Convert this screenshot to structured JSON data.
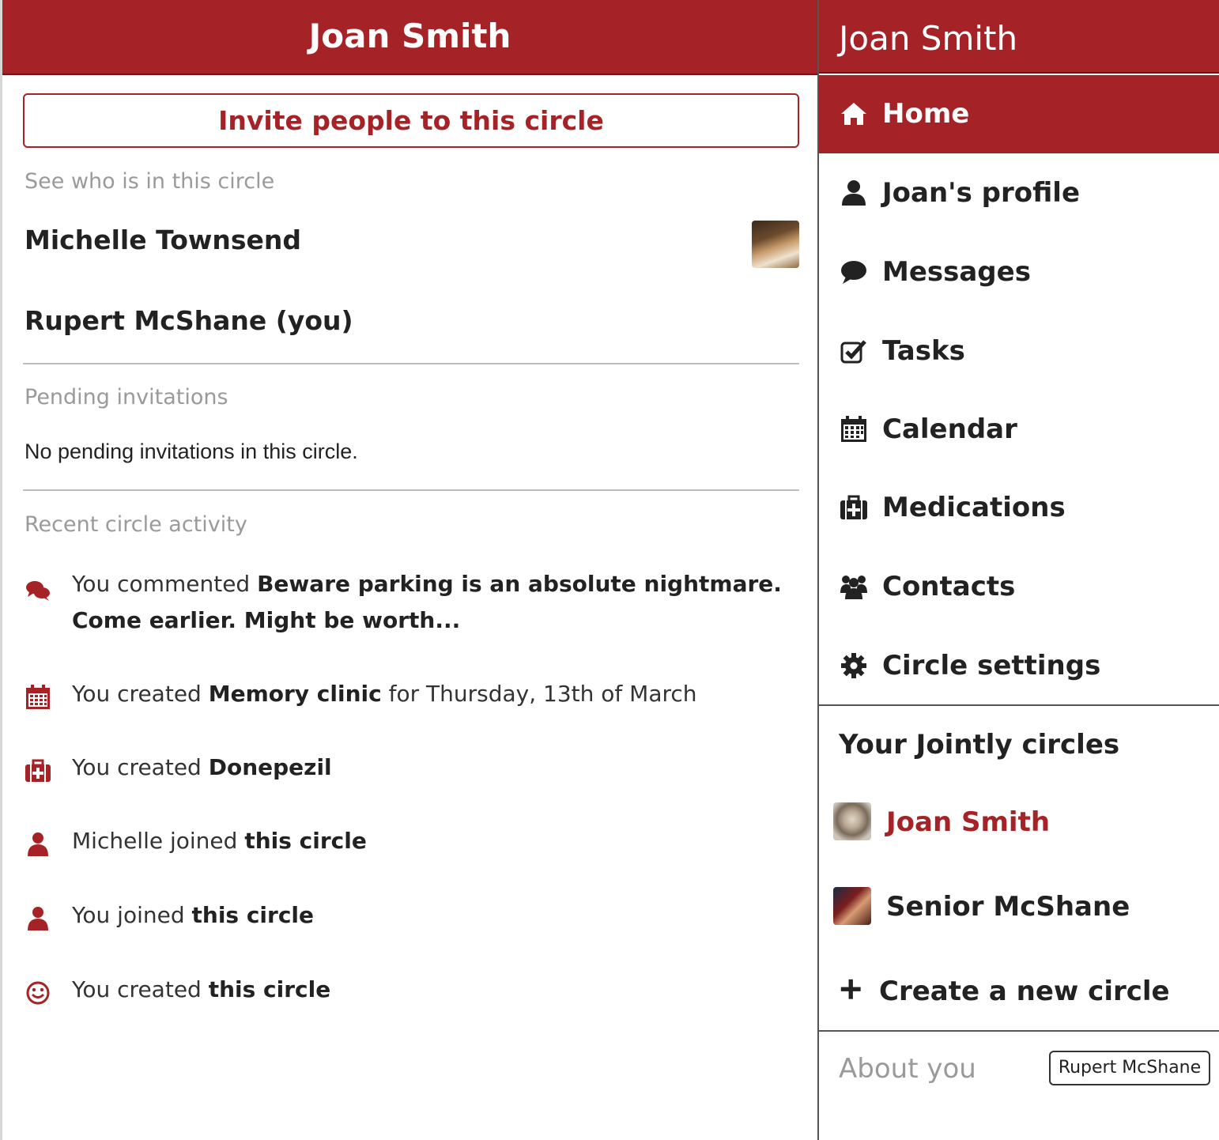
{
  "main": {
    "title": "Joan Smith",
    "invite_label": "Invite people to this circle",
    "members_heading": "See who is in this circle",
    "members": [
      "Michelle Townsend",
      "Rupert McShane (you)"
    ],
    "pending_heading": "Pending invitations",
    "pending_text": "No pending invitations in this circle.",
    "activity_heading": "Recent circle activity",
    "activity": [
      {
        "icon": "comments-icon",
        "pre": "You commented ",
        "bold": "Beware parking is an absolute nightmare. Come earlier. Might be worth...",
        "post": ""
      },
      {
        "icon": "calendar-icon",
        "pre": "You created ",
        "bold": "Memory clinic",
        "post": " for Thursday, 13th of March"
      },
      {
        "icon": "medkit-icon",
        "pre": "You created ",
        "bold": "Donepezil",
        "post": ""
      },
      {
        "icon": "user-icon",
        "pre": "Michelle joined ",
        "bold": "this circle",
        "post": ""
      },
      {
        "icon": "user-icon",
        "pre": "You joined ",
        "bold": "this circle",
        "post": ""
      },
      {
        "icon": "smile-icon",
        "pre": "You created ",
        "bold": "this circle",
        "post": ""
      }
    ]
  },
  "sidebar": {
    "title": "Joan Smith",
    "nav": [
      {
        "label": "Home",
        "icon": "home-icon",
        "active": true
      },
      {
        "label": "Joan's profile",
        "icon": "user-icon"
      },
      {
        "label": "Messages",
        "icon": "comment-icon"
      },
      {
        "label": "Tasks",
        "icon": "check-square-icon"
      },
      {
        "label": "Calendar",
        "icon": "calendar-icon"
      },
      {
        "label": "Medications",
        "icon": "medkit-icon"
      },
      {
        "label": "Contacts",
        "icon": "group-icon"
      },
      {
        "label": "Circle settings",
        "icon": "gear-icon"
      }
    ],
    "circles_heading": "Your Jointly circles",
    "circles": [
      {
        "label": "Joan Smith",
        "current": true
      },
      {
        "label": "Senior McShane",
        "current": false
      }
    ],
    "create_label": "Create a new circle",
    "about_label": "About you",
    "about_user": "Rupert McShane"
  },
  "colors": {
    "accent": "#a52226",
    "text": "#222222",
    "muted": "#9a9a9a"
  }
}
